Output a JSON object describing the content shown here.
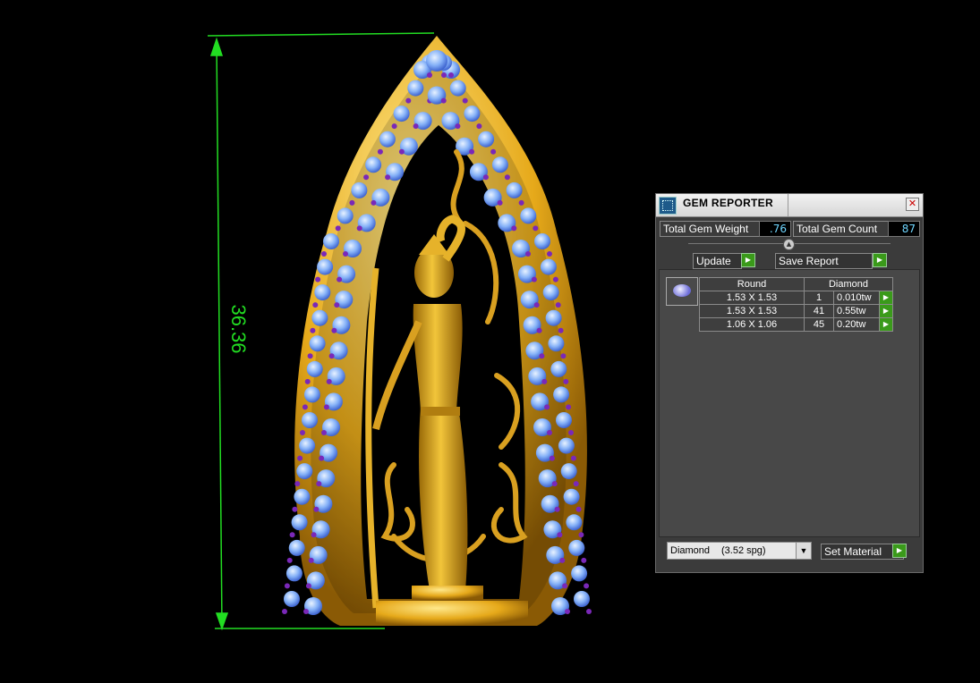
{
  "dimension": {
    "value": "36.36",
    "color": "#22dd22"
  },
  "gem_reporter": {
    "title": "GEM REPORTER",
    "total_gem_weight_label": "Total Gem Weight",
    "total_gem_weight_value": ".76",
    "total_gem_count_label": "Total Gem Count",
    "total_gem_count_value": "87",
    "update_label": "Update",
    "save_report_label": "Save Report",
    "table_headers": {
      "shape": "Round",
      "material": "Diamond"
    },
    "rows": [
      {
        "size": "1.53 X 1.53",
        "count": "1",
        "weight": "0.010tw"
      },
      {
        "size": "1.53 X 1.53",
        "count": "41",
        "weight": "0.55tw"
      },
      {
        "size": "1.06 X 1.06",
        "count": "45",
        "weight": "0.20tw"
      }
    ],
    "material_select": {
      "name": "Diamond",
      "spg": "(3.52 spg)"
    },
    "set_material_label": "Set Material"
  },
  "colors": {
    "gold": "#e6a91a",
    "gem_blue": "#7aaaf5",
    "accent_green": "#3a9a1a",
    "value_cyan": "#6fd6ff"
  }
}
